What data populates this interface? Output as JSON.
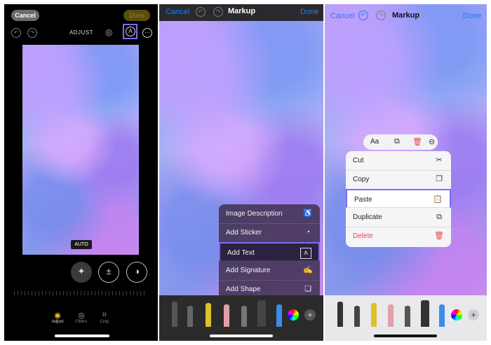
{
  "panel1": {
    "cancel": "Cancel",
    "done": "Done",
    "title": "ADJUST",
    "auto": "AUTO",
    "tools": [
      {
        "label": "Adjust",
        "icon": "adjust-icon"
      },
      {
        "label": "Filters",
        "icon": "filters-icon"
      },
      {
        "label": "Crop",
        "icon": "crop-icon"
      }
    ]
  },
  "panel2": {
    "cancel": "Cancel",
    "title": "Markup",
    "done": "Done",
    "menu": [
      {
        "label": "Image Description",
        "icon": "accessibility-icon"
      },
      {
        "label": "Add Sticker",
        "icon": "sticker-icon"
      },
      {
        "label": "Add Text",
        "icon": "text-box-icon"
      },
      {
        "label": "Add Signature",
        "icon": "signature-icon"
      },
      {
        "label": "Add Shape",
        "icon": "shape-icon"
      }
    ]
  },
  "panel3": {
    "cancel": "Cancel",
    "title": "Markup",
    "done": "Done",
    "minibar": {
      "font": "Aa"
    },
    "menu": [
      {
        "label": "Cut",
        "icon": "scissors-icon"
      },
      {
        "label": "Copy",
        "icon": "copy-icon"
      },
      {
        "label": "Paste",
        "icon": "paste-icon"
      },
      {
        "label": "Duplicate",
        "icon": "duplicate-icon"
      },
      {
        "label": "Delete",
        "icon": "trash-icon"
      }
    ]
  },
  "colors": {
    "accent": "#1e7cf0",
    "highlight": "#7b6df2",
    "delete": "#e5484d"
  }
}
